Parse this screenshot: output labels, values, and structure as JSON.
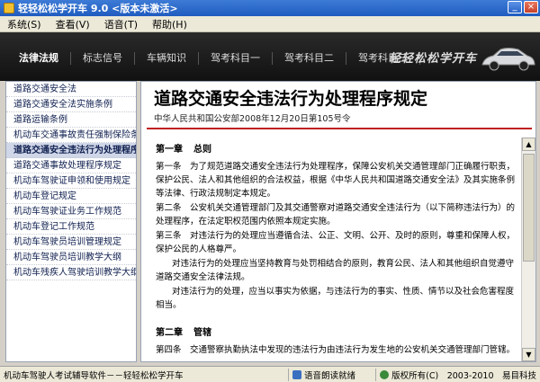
{
  "window": {
    "title": "轻轻松松学开车 9.0 <版本未激活>"
  },
  "menu": [
    "系统(S)",
    "查看(V)",
    "语音(T)",
    "帮助(H)"
  ],
  "nav": {
    "tabs": [
      "法律法规",
      "标志信号",
      "车辆知识",
      "驾考科目一",
      "驾考科目二",
      "驾考科目三"
    ],
    "logo": "轻轻松松学开车"
  },
  "sidebar": {
    "items": [
      "道路交通安全法",
      "道路交通安全法实施条例",
      "道路运输条例",
      "机动车交通事故责任强制保险条",
      "道路交通安全违法行为处理程序",
      "道路交通事故处理程序规定",
      "机动车驾驶证申领和使用规定",
      "机动车登记规定",
      "机动车驾驶证业务工作规范",
      "机动车登记工作规范",
      "机动车驾驶员培训管理规定",
      "机动车驾驶员培训教学大纲",
      "机动车残疾人驾驶培训教学大纲"
    ]
  },
  "doc": {
    "title": "道路交通安全违法行为处理程序规定",
    "meta": "中华人民共和国公安部2008年12月20日第105号令",
    "ch1_label": "第一章",
    "ch1_name": "总则",
    "p1": "第一条　为了规范道路交通安全违法行为处理程序，保障公安机关交通管理部门正确履行职责，保护公民、法人和其他组织的合法权益，根据《中华人民共和国道路交通安全法》及其实施条例等法律、行政法规制定本规定。",
    "p2": "第二条　公安机关交通管理部门及其交通警察对道路交通安全违法行为（以下简称违法行为）的处理程序，在法定职权范围内依照本规定实施。",
    "p3": "第三条　对违法行为的处理应当遵循合法、公正、文明、公开、及时的原则，尊重和保障人权，保护公民的人格尊严。",
    "p4": "对违法行为的处理应当坚持教育与处罚相结合的原则，教育公民、法人和其他组织自觉遵守道路交通安全法律法规。",
    "p5": "对违法行为的处理，应当以事实为依据，与违法行为的事实、性质、情节以及社会危害程度相当。",
    "ch2_label": "第二章",
    "ch2_name": "管辖",
    "p6": "第四条　交通警察执勤执法中发现的违法行为由违法行为发生地的公安机关交通管理部门管辖。"
  },
  "status": {
    "left": "机动车驾驶人考试辅导软件－－轻轻松松学开车",
    "voice": "语音朗读就绪",
    "copyright": "版权所有(C)　2003-2010　易目科技"
  },
  "colors": {
    "accent_red": "#c02020",
    "nav_bg": "#111111"
  }
}
